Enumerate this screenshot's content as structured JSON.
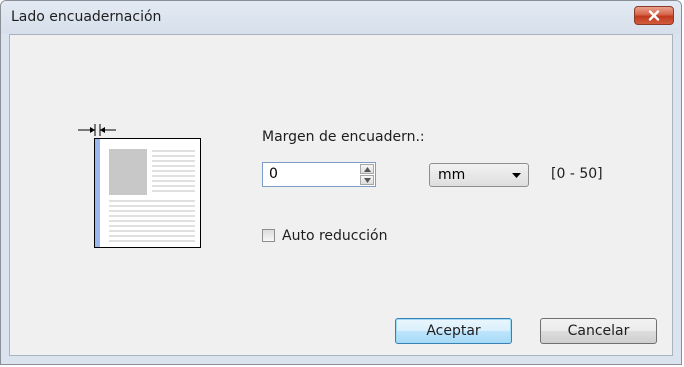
{
  "window": {
    "title": "Lado encuadernación",
    "close_icon": "close-icon"
  },
  "margin": {
    "label": "Margen de encuadern.:",
    "value": "0",
    "unit": "mm",
    "range": "[0 - 50]"
  },
  "auto_reduce": {
    "label": "Auto reducción",
    "checked": false
  },
  "buttons": {
    "accept": "Aceptar",
    "cancel": "Cancelar"
  },
  "colors": {
    "binding_edge": "#9ab7ee",
    "default_button_border": "#3c7fb1"
  }
}
